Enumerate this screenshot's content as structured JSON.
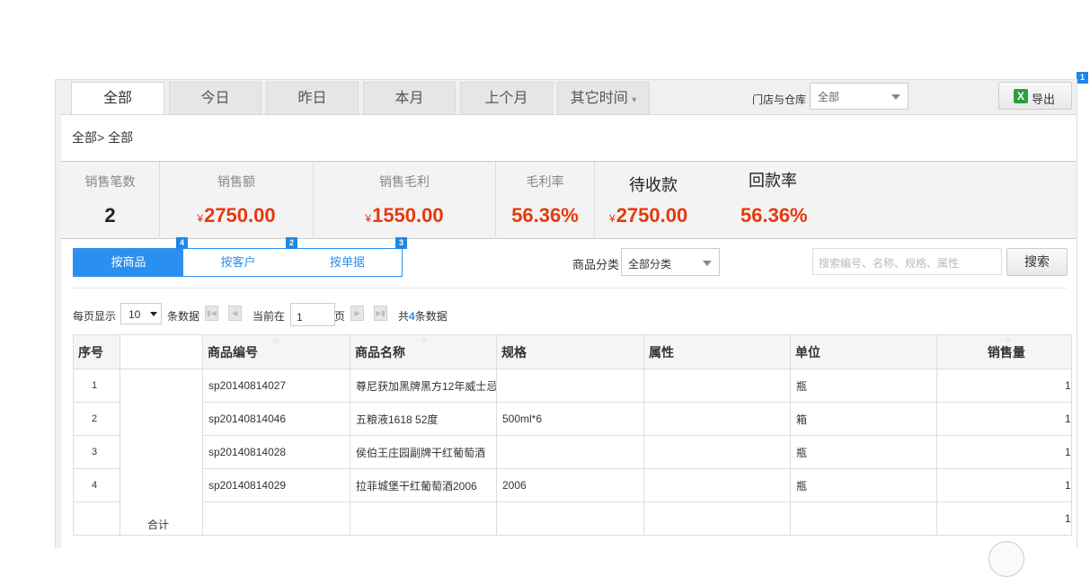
{
  "badges": [
    "1",
    "4",
    "2",
    "3"
  ],
  "tabs": [
    {
      "label": "全部"
    },
    {
      "label": "今日"
    },
    {
      "label": "昨日"
    },
    {
      "label": "本月"
    },
    {
      "label": "上个月"
    },
    {
      "label": "其它时间"
    }
  ],
  "dropdown_arrow": "▾",
  "store": {
    "label": "门店与仓库",
    "value": "全部"
  },
  "export_label": "导出",
  "export_icon_glyph": "X",
  "breadcrumb": "全部> 全部",
  "stats": [
    {
      "label": "销售笔数",
      "value": "2",
      "currency": ""
    },
    {
      "label": "销售额",
      "value": "2750.00",
      "currency": "¥"
    },
    {
      "label": "销售毛利",
      "value": "1550.00",
      "currency": "¥"
    },
    {
      "label": "毛利率",
      "value": "56.36%",
      "currency": ""
    },
    {
      "label": "待收款",
      "value": "2750.00",
      "currency": "¥"
    },
    {
      "label": "回款率",
      "value": "56.36%",
      "currency": ""
    }
  ],
  "view_modes": [
    "按商品",
    "按客户",
    "按单据"
  ],
  "category": {
    "label": "商品分类",
    "value": "全部分类"
  },
  "search": {
    "placeholder": "搜索编号、名称、规格、属性",
    "button": "搜索"
  },
  "pager": {
    "per_page_label": "每页显示",
    "per_page": "10",
    "per_page_suffix": "条数据",
    "current_label": "当前在",
    "current": "1",
    "page_suffix": "页",
    "total_prefix": "共",
    "total": "4",
    "total_suffix": "条数据"
  },
  "table": {
    "headers": [
      "序号",
      "",
      "商品编号",
      "商品名称",
      "规格",
      "属性",
      "单位",
      "销售量"
    ],
    "rows": [
      [
        "1",
        "",
        "sp20140814027",
        "尊尼获加黑牌黑方12年威士忌",
        "",
        "",
        "瓶",
        "1"
      ],
      [
        "2",
        "",
        "sp20140814046",
        "五粮液1618 52度",
        "500ml*6",
        "",
        "箱",
        "1"
      ],
      [
        "3",
        "",
        "sp20140814028",
        "侯伯王庄园副牌干红葡萄酒",
        "",
        "",
        "瓶",
        "1"
      ],
      [
        "4",
        "",
        "sp20140814029",
        "拉菲城堡干红葡萄酒2006",
        "2006",
        "",
        "瓶",
        "1"
      ],
      [
        "",
        "合计",
        "",
        "",
        "",
        "",
        "",
        "1"
      ]
    ]
  }
}
